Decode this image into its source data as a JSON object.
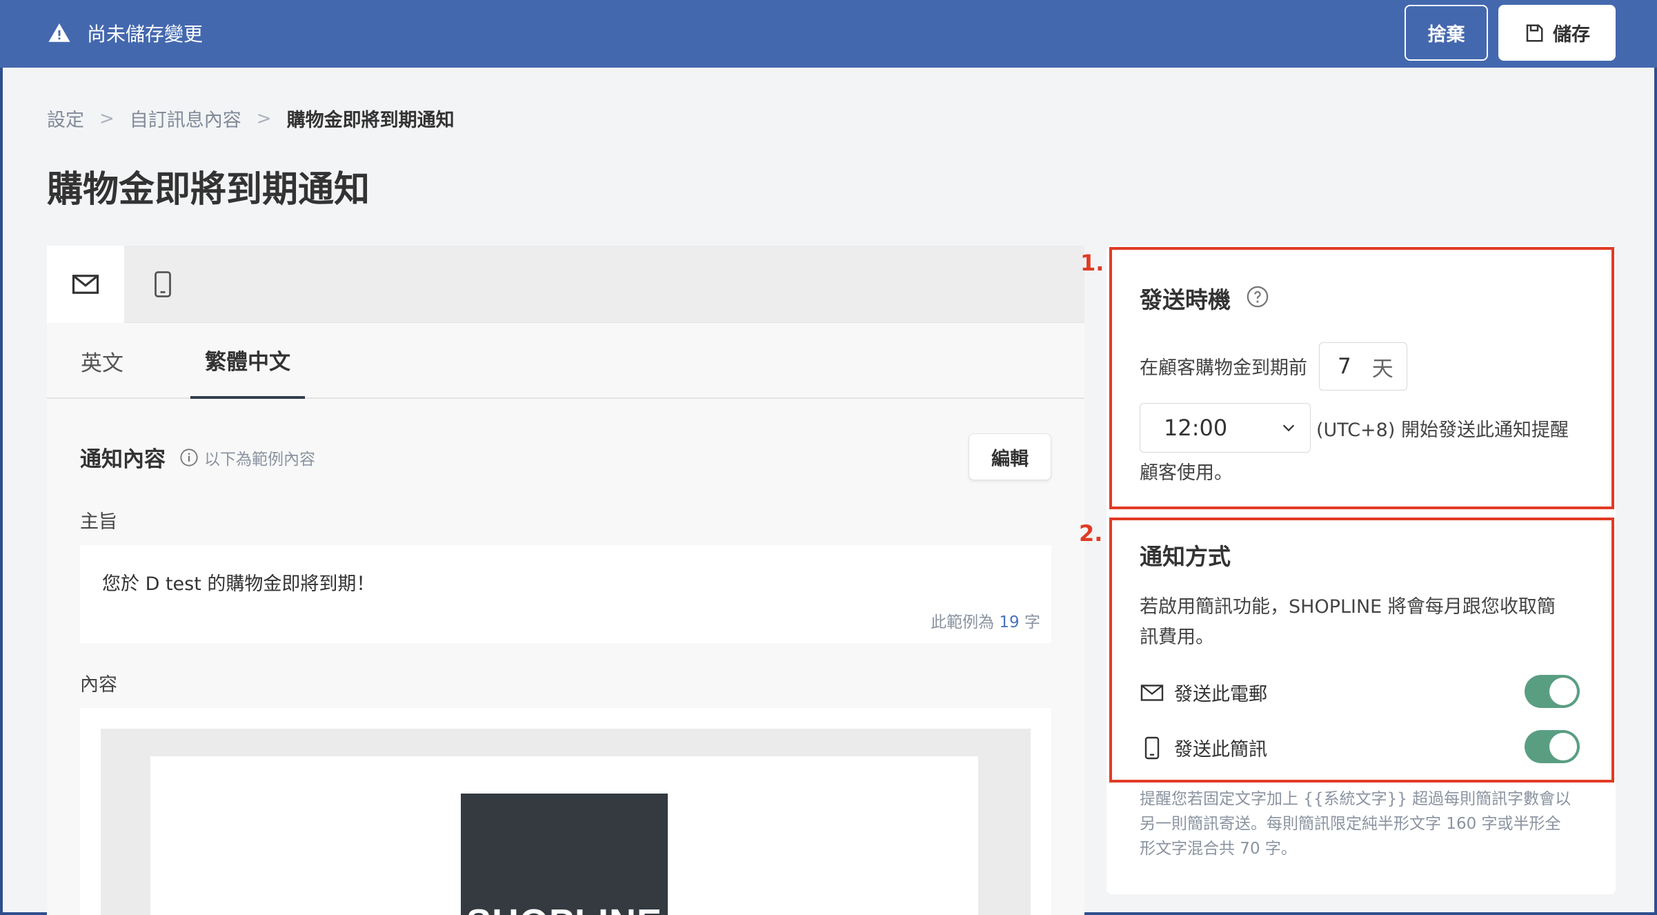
{
  "topbar": {
    "warning_text": "尚未儲存變更",
    "discard_label": "捨棄",
    "save_label": "儲存"
  },
  "breadcrumb": {
    "items": [
      "設定",
      "自訂訊息內容"
    ],
    "current": "購物金即將到期通知",
    "separator": ">"
  },
  "page_title": "購物金即將到期通知",
  "channel_tabs": [
    "email-icon",
    "phone-icon"
  ],
  "language_tabs": {
    "english": "英文",
    "traditional_chinese": "繁體中文",
    "active": "繁體中文"
  },
  "notification_content": {
    "title": "通知內容",
    "info_text": "以下為範例內容",
    "edit_label": "編輯",
    "subject_label": "主旨",
    "subject_value": "您於 D test 的購物金即將到期！",
    "count_prefix": "此範例為",
    "count_value": "19",
    "count_suffix": "字",
    "content_label": "內容",
    "logo_text": "SHOPLINE"
  },
  "send_timing": {
    "number": "1.",
    "title": "發送時機",
    "before_text": "在顧客購物金到期前",
    "days_value": "7",
    "days_unit": "天",
    "time_value": "12:00",
    "after_text_line1": "(UTC+8) 開始發送此通知提醒",
    "after_text_line2": "顧客使用。"
  },
  "notification_method": {
    "number": "2.",
    "title": "通知方式",
    "desc_line1": "若啟用簡訊功能，SHOPLINE 將會每月跟您收取簡",
    "desc_line2": "訊費用。",
    "email_toggle_label": "發送此電郵",
    "email_toggle_on": true,
    "sms_toggle_label": "發送此簡訊",
    "sms_toggle_on": true,
    "note_line1": "提醒您若固定文字加上 {{系統文字}} 超過每則簡訊字數會以",
    "note_line2": "另一則簡訊寄送。每則簡訊限定純半形文字 160 字或半形全",
    "note_line3": "形文字混合共 70 字。"
  },
  "colors": {
    "topbar": "#4468ae",
    "annotation_red": "#e03b24",
    "toggle_on": "#5a9e82",
    "count_blue": "#4a73c2"
  }
}
